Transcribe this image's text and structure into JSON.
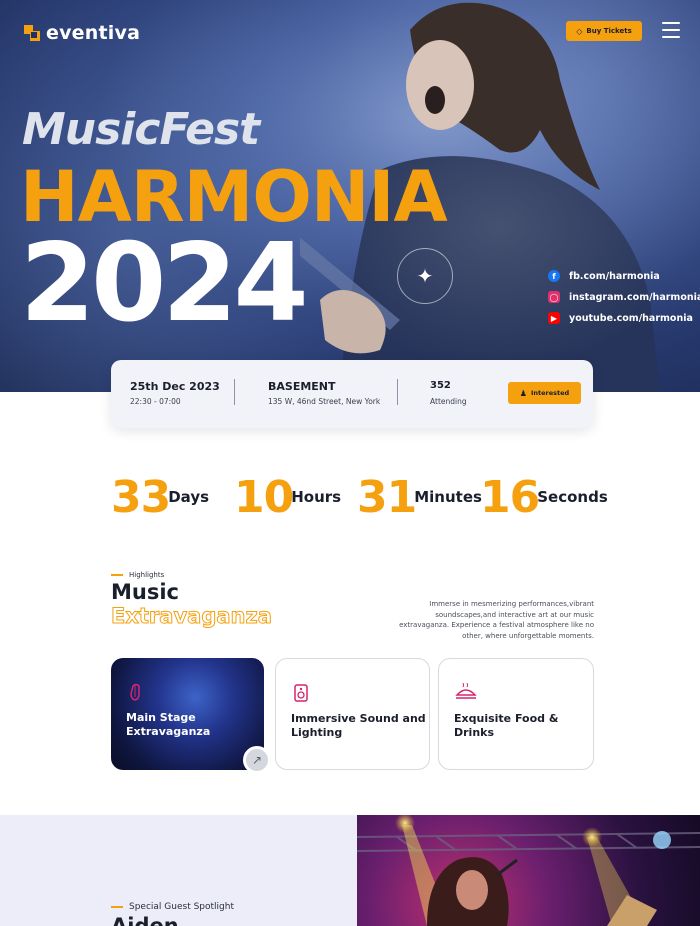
{
  "brand": {
    "name": "eventiva"
  },
  "nav": {
    "buy_tickets_label": "Buy Tickets",
    "menu_icon": "hamburger-menu-icon"
  },
  "hero": {
    "subtitle": "MusicFest",
    "title": "HARMONIA",
    "year": "2024",
    "socials": [
      {
        "icon": "facebook-icon",
        "label": "fb.com/harmonia",
        "color": "#1877f2"
      },
      {
        "icon": "instagram-icon",
        "label": "instagram.com/harmonia",
        "color": "#e1306c"
      },
      {
        "icon": "youtube-icon",
        "label": "youtube.com/harmonia",
        "color": "#ff0000"
      }
    ]
  },
  "event": {
    "date": "25th Dec 2023",
    "time": "22:30 - 07:00",
    "venue": "BASEMENT",
    "address": "135 W, 46nd Street, New York",
    "attending_count": "352",
    "attending_label": "Attending",
    "interested_label": "Interested"
  },
  "countdown": [
    {
      "value": "33",
      "label": "Days"
    },
    {
      "value": "10",
      "label": "Hours"
    },
    {
      "value": "31",
      "label": "Minutes"
    },
    {
      "value": "16",
      "label": "Seconds"
    }
  ],
  "highlights": {
    "tag": "Highlights",
    "title_line1": "Music",
    "title_line2": "Extravaganza",
    "description": "Immerse in mesmerizing performances,vibrant soundscapes,and interactive art at our music extravaganza. Experience a festival atmosphere like no other, where unforgettable moments.",
    "cards": [
      {
        "title": "Main Stage Extravaganza",
        "icon": "guitar-icon"
      },
      {
        "title": "Immersive Sound and Lighting",
        "icon": "speaker-icon"
      },
      {
        "title": "Exquisite Food & Drinks",
        "icon": "food-icon"
      }
    ]
  },
  "spotlight": {
    "tag": "Special Guest Spotlight",
    "name": "Aiden"
  },
  "colors": {
    "accent": "#f5a00f",
    "dark": "#1b1f2b",
    "pink_icon": "#d6246e"
  }
}
